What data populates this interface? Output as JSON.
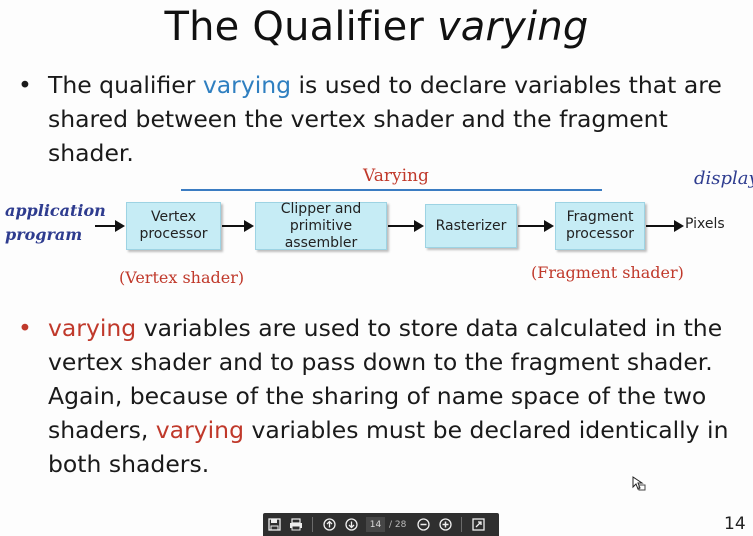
{
  "slide": {
    "title_plain": "The Qualifier ",
    "title_italic": "varying",
    "bullet1": {
      "pre": "The qualifier ",
      "kw": "varying",
      "post": " is used to declare variables that are shared between the vertex shader and the fragment shader."
    },
    "diagram": {
      "varying_label": "Varying",
      "display_label": "display",
      "app_label_line1": "application",
      "app_label_line2": "program",
      "boxes": [
        {
          "l1": "Vertex",
          "l2": "processor"
        },
        {
          "l1": "Clipper and",
          "l2": "primitive assembler"
        },
        {
          "l1": "Rasterizer",
          "l2": ""
        },
        {
          "l1": "Fragment",
          "l2": "processor"
        }
      ],
      "pixels": "Pixels",
      "vertex_shader_label": "(Vertex shader)",
      "fragment_shader_label": "(Fragment shader)"
    },
    "bullet2": {
      "kw1": "varying",
      "part1": " variables are used to store data calculated in the vertex shader and to pass down to the fragment shader. Again, because of the sharing of name space of the two shaders, ",
      "kw2": "varying",
      "part2": " variables must be declared identically in both shaders."
    },
    "slide_number": "14"
  },
  "toolbar": {
    "save_icon": "save-icon",
    "print_icon": "print-icon",
    "page_current": "14",
    "page_total": "/ 28",
    "zoom_out_icon": "zoom-out-icon",
    "zoom_in_icon": "zoom-in-icon",
    "fit_icon": "fit-page-icon"
  },
  "colors": {
    "accent_blue": "#2f7fc0",
    "accent_red": "#c0392b",
    "box_fill": "#c6ecf5"
  }
}
